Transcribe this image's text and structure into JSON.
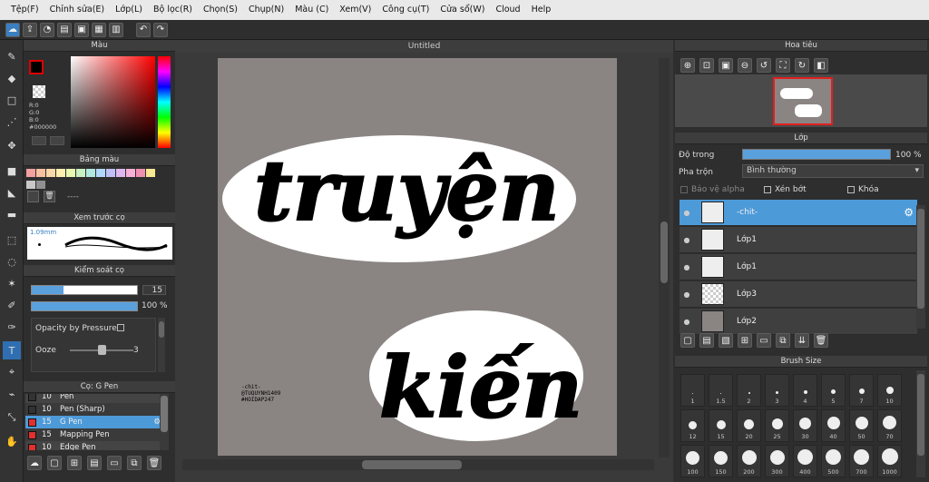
{
  "menu": [
    "Tệp(F)",
    "Chỉnh sửa(E)",
    "Lớp(L)",
    "Bộ lọc(R)",
    "Chọn(S)",
    "Chụp(N)",
    "Màu (C)",
    "Xem(V)",
    "Công cụ(T)",
    "Cửa sổ(W)",
    "Cloud",
    "Help"
  ],
  "canvas_title": "Untitled",
  "color_panel": {
    "title": "Màu",
    "r": "R:0",
    "g": "G:0",
    "b": "B:0",
    "hex": "#000000"
  },
  "palette": {
    "title": "Bảng màu",
    "dash": "----"
  },
  "preview": {
    "title": "Xem trước cọ",
    "size": "1.09mm"
  },
  "brush_control": {
    "title": "Kiểm soát cọ",
    "size_val": "15",
    "opacity_val": "100 %",
    "pressure_label": "Opacity by Pressure",
    "ooze_label": "Ooze",
    "ooze_val": "3"
  },
  "brushes": {
    "title": "Cọ: G Pen",
    "items": [
      {
        "size": "10",
        "name": "Pen"
      },
      {
        "size": "10",
        "name": "Pen (Sharp)"
      },
      {
        "size": "15",
        "name": "G Pen"
      },
      {
        "size": "15",
        "name": "Mapping Pen"
      },
      {
        "size": "10",
        "name": "Edge Pen"
      }
    ]
  },
  "navigator": {
    "title": "Hoa tiêu"
  },
  "layers": {
    "title": "Lớp",
    "opacity_label": "Độ trong",
    "opacity_val": "100 %",
    "blend_label": "Pha trộn",
    "blend_val": "Bình thường",
    "alpha": "Bảo vệ alpha",
    "clip": "Xén bớt",
    "lock": "Khóa",
    "items": [
      {
        "name": "-chit-"
      },
      {
        "name": "Lớp1"
      },
      {
        "name": "Lớp1"
      },
      {
        "name": "Lớp3"
      },
      {
        "name": "Lớp2"
      }
    ]
  },
  "brush_size": {
    "title": "Brush Size",
    "sizes": [
      "1",
      "1.5",
      "2",
      "3",
      "4",
      "5",
      "7",
      "10",
      "12",
      "15",
      "20",
      "25",
      "30",
      "40",
      "50",
      "70",
      "100",
      "150",
      "200",
      "300",
      "400",
      "500",
      "700",
      "1000"
    ]
  },
  "art": {
    "line1": "truyện",
    "line2": "kiến",
    "signature": [
      "-chit-",
      "@TUQUYNH1409",
      "#HOIDAP247"
    ]
  },
  "colors": {
    "accent": "#4d9ad8",
    "active_tool": "#2f6fb1",
    "canvas": "#8a8583"
  }
}
